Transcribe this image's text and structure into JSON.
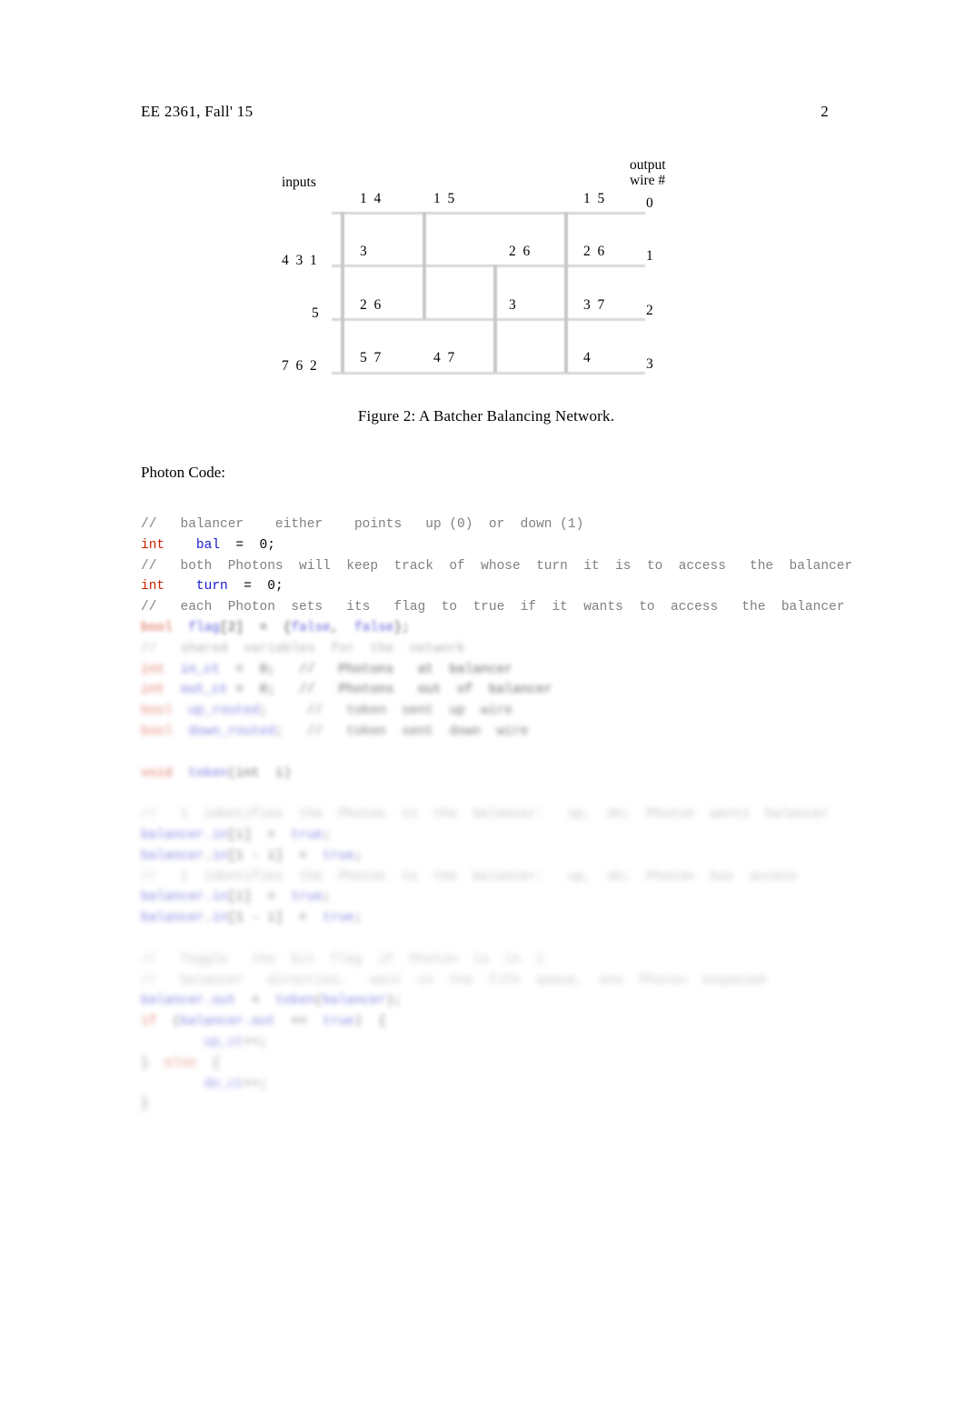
{
  "header": {
    "course": "EE 2361, Fall' 15",
    "page_number": "2"
  },
  "figure": {
    "caption": "Figure 2: A  Batcher  Balancing  Network.",
    "inputs_label": "inputs",
    "output_label_line1": "output",
    "output_label_line2": "wire #",
    "output_wire_numbers": [
      "0",
      "1",
      "2",
      "3"
    ],
    "input_tokens": [
      {
        "text": "4  3  1",
        "row": 1
      },
      {
        "text": "5",
        "row": 2
      },
      {
        "text": "7  6  2",
        "row": 3
      }
    ],
    "wire_tokens": [
      {
        "text": "1  4",
        "row": 0,
        "col": 0
      },
      {
        "text": "1  5",
        "row": 0,
        "col": 1
      },
      {
        "text": "1  5",
        "row": 0,
        "col": 2
      },
      {
        "text": "3",
        "row": 1,
        "col": 0
      },
      {
        "text": "2  6",
        "row": 1,
        "col": 1
      },
      {
        "text": "2  6",
        "row": 1,
        "col": 2
      },
      {
        "text": "2  6",
        "row": 2,
        "col": 0
      },
      {
        "text": "3",
        "row": 2,
        "col": 1
      },
      {
        "text": "3  7",
        "row": 2,
        "col": 2
      },
      {
        "text": "5  7",
        "row": 3,
        "col": 0
      },
      {
        "text": "4  7",
        "row": 3,
        "col": 1
      },
      {
        "text": "4",
        "row": 3,
        "col": 2
      }
    ]
  },
  "body": {
    "photon_code_heading": "Photon Code:"
  },
  "code": {
    "lines": [
      {
        "blur": 0,
        "tokens": [
          {
            "c": "cm",
            "t": "//   balancer    either    points   up (0)  or  down (1)"
          }
        ]
      },
      {
        "blur": 0,
        "tokens": [
          {
            "c": "kw",
            "t": "int"
          },
          {
            "c": "pl",
            "t": "    "
          },
          {
            "c": "id",
            "t": "bal"
          },
          {
            "c": "pl",
            "t": "  =  0;"
          }
        ]
      },
      {
        "blur": 0,
        "tokens": [
          {
            "c": "cm",
            "t": "//   both  Photons  will  keep  track  of  whose  turn  it  is  to  access   the  balancer"
          }
        ]
      },
      {
        "blur": 0,
        "tokens": [
          {
            "c": "kw",
            "t": "int"
          },
          {
            "c": "pl",
            "t": "    "
          },
          {
            "c": "id",
            "t": "turn"
          },
          {
            "c": "pl",
            "t": "  =  0;"
          }
        ]
      },
      {
        "blur": 0,
        "tokens": [
          {
            "c": "cm",
            "t": "//   each  Photon  sets   its   flag  to  true  if  it  wants  to  access   the  balancer"
          }
        ]
      },
      {
        "blur": 1,
        "tokens": [
          {
            "c": "kw",
            "t": "bool"
          },
          {
            "c": "pl",
            "t": "  "
          },
          {
            "c": "id",
            "t": "flag"
          },
          {
            "c": "pl",
            "t": "[2]  =  {"
          },
          {
            "c": "id",
            "t": "false"
          },
          {
            "c": "pl",
            "t": ",  "
          },
          {
            "c": "id",
            "t": "false"
          },
          {
            "c": "pl",
            "t": "};"
          }
        ]
      },
      {
        "blur": 2,
        "tokens": [
          {
            "c": "cm",
            "t": "//   shared  variables  for  the  network"
          }
        ]
      },
      {
        "blur": 2,
        "tokens": [
          {
            "c": "kw",
            "t": "int"
          },
          {
            "c": "pl",
            "t": "  "
          },
          {
            "c": "id",
            "t": "in_ct"
          },
          {
            "c": "pl",
            "t": "  =  0;   //   Photons   at  balancer"
          }
        ]
      },
      {
        "blur": 2,
        "tokens": [
          {
            "c": "kw",
            "t": "int"
          },
          {
            "c": "pl",
            "t": "  "
          },
          {
            "c": "id",
            "t": "out_ct"
          },
          {
            "c": "pl",
            "t": " =  0;   //   Photons   out  of  balancer"
          }
        ]
      },
      {
        "blur": 3,
        "tokens": [
          {
            "c": "kw",
            "t": "bool"
          },
          {
            "c": "pl",
            "t": "  "
          },
          {
            "c": "id",
            "t": "up_routed"
          },
          {
            "c": "pl",
            "t": ";     //   token  sent  up  wire"
          }
        ]
      },
      {
        "blur": 3,
        "tokens": [
          {
            "c": "kw",
            "t": "bool"
          },
          {
            "c": "pl",
            "t": "  "
          },
          {
            "c": "id",
            "t": "down_routed"
          },
          {
            "c": "pl",
            "t": ";   //   token  sent  down  wire"
          }
        ]
      },
      {
        "blur": 0,
        "tokens": [
          {
            "c": "pl",
            "t": ""
          }
        ]
      },
      {
        "blur": 2,
        "tokens": [
          {
            "c": "kw",
            "t": "void"
          },
          {
            "c": "pl",
            "t": "  "
          },
          {
            "c": "id",
            "t": "token"
          },
          {
            "c": "pl",
            "t": "(int  i)"
          }
        ]
      },
      {
        "blur": 0,
        "tokens": [
          {
            "c": "pl",
            "t": ""
          }
        ]
      },
      {
        "blur": 4,
        "tokens": [
          {
            "c": "cm",
            "t": "//   i  identifies  the  Photon  to  the  balancer:   up,  dn;  Photon  wants  balancer"
          }
        ]
      },
      {
        "blur": 3,
        "tokens": [
          {
            "c": "id",
            "t": "balancer.in"
          },
          {
            "c": "pl",
            "t": "[i]  =  "
          },
          {
            "c": "id",
            "t": "true"
          },
          {
            "c": "pl",
            "t": ";"
          }
        ]
      },
      {
        "blur": 3,
        "tokens": [
          {
            "c": "id",
            "t": "balancer"
          },
          {
            "c": "pl",
            "t": "."
          },
          {
            "c": "id",
            "t": "in"
          },
          {
            "c": "pl",
            "t": "[1 - i]  =  "
          },
          {
            "c": "id",
            "t": "true"
          },
          {
            "c": "pl",
            "t": ";"
          }
        ]
      },
      {
        "blur": 4,
        "tokens": [
          {
            "c": "cm",
            "t": "//   i  identifies  the  Photon  to  the  balancer:   up,  dn;  Photon  has  access"
          }
        ]
      },
      {
        "blur": 3,
        "tokens": [
          {
            "c": "id",
            "t": "balancer.in"
          },
          {
            "c": "pl",
            "t": "[i]  =  "
          },
          {
            "c": "id",
            "t": "true"
          },
          {
            "c": "pl",
            "t": ";"
          }
        ]
      },
      {
        "blur": 3,
        "tokens": [
          {
            "c": "id",
            "t": "balancer"
          },
          {
            "c": "pl",
            "t": "."
          },
          {
            "c": "id",
            "t": "in"
          },
          {
            "c": "pl",
            "t": "[1 - i]  =  "
          },
          {
            "c": "id",
            "t": "true"
          },
          {
            "c": "pl",
            "t": ";"
          }
        ]
      },
      {
        "blur": 0,
        "tokens": [
          {
            "c": "pl",
            "t": ""
          }
        ]
      },
      {
        "blur": 5,
        "tokens": [
          {
            "c": "cm",
            "t": "//   Toggle   the  bit  flag  if  Photon  is  in  i"
          }
        ]
      },
      {
        "blur": 5,
        "tokens": [
          {
            "c": "cm",
            "t": "//   balancer   direction,   wait  in  the  fifo  queue,  one  Photon  enqueued"
          }
        ]
      },
      {
        "blur": 3,
        "tokens": [
          {
            "c": "id",
            "t": "balancer.out"
          },
          {
            "c": "pl",
            "t": "  =  "
          },
          {
            "c": "id",
            "t": "token"
          },
          {
            "c": "pl",
            "t": "("
          },
          {
            "c": "id",
            "t": "balancer"
          },
          {
            "c": "pl",
            "t": ");"
          }
        ]
      },
      {
        "blur": 3,
        "tokens": [
          {
            "c": "kw",
            "t": "if"
          },
          {
            "c": "pl",
            "t": "  ("
          },
          {
            "c": "id",
            "t": "balancer.out"
          },
          {
            "c": "pl",
            "t": "  ==  "
          },
          {
            "c": "id",
            "t": "true"
          },
          {
            "c": "pl",
            "t": ")  {"
          }
        ]
      },
      {
        "blur": 4,
        "tokens": [
          {
            "c": "pl",
            "t": "        "
          },
          {
            "c": "id",
            "t": "up_ct"
          },
          {
            "c": "pl",
            "t": "++;"
          }
        ]
      },
      {
        "blur": 4,
        "tokens": [
          {
            "c": "pl",
            "t": "}  "
          },
          {
            "c": "kw",
            "t": "else"
          },
          {
            "c": "pl",
            "t": "  {"
          }
        ]
      },
      {
        "blur": 4,
        "tokens": [
          {
            "c": "pl",
            "t": "        "
          },
          {
            "c": "id",
            "t": "dn_ct"
          },
          {
            "c": "pl",
            "t": "++;"
          }
        ]
      },
      {
        "blur": 4,
        "tokens": [
          {
            "c": "pl",
            "t": "}"
          }
        ]
      }
    ]
  }
}
